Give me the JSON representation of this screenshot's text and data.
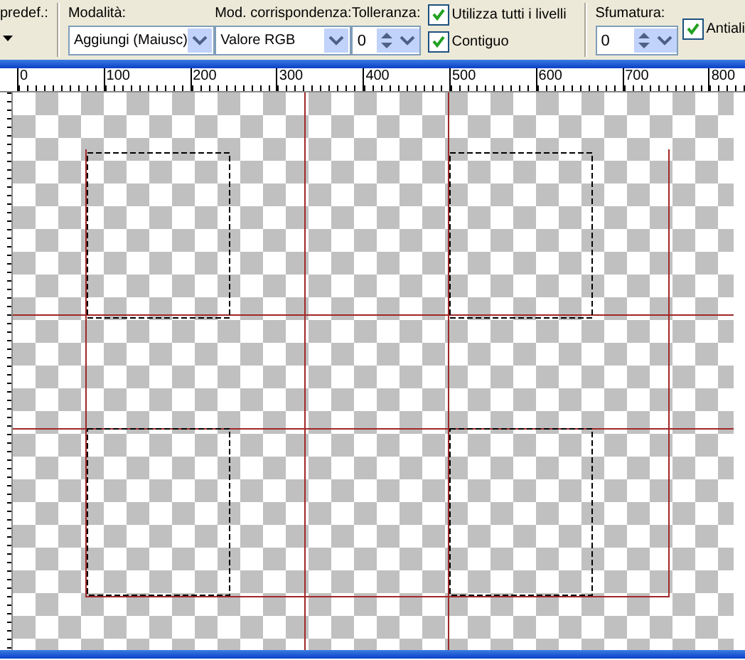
{
  "toolbar": {
    "preset_label": "predef.:",
    "mode": {
      "label": "Modalità:",
      "value": "Aggiungi (Maiusc)"
    },
    "match_mode": {
      "label": "Mod. corrispondenza:",
      "value": "Valore RGB"
    },
    "tolerance": {
      "label": "Tolleranza:",
      "value": "0"
    },
    "checkboxes": [
      {
        "label": "Utilizza tutti i livelli",
        "checked": true
      },
      {
        "label": "Contiguo",
        "checked": true
      }
    ],
    "feather": {
      "label": "Sfumatura:",
      "value": "0"
    },
    "antialias": {
      "label": "Antiali",
      "checked": true
    }
  },
  "ruler": {
    "labels": [
      "0",
      "100",
      "200",
      "300",
      "400",
      "500",
      "600",
      "700",
      "800"
    ]
  }
}
